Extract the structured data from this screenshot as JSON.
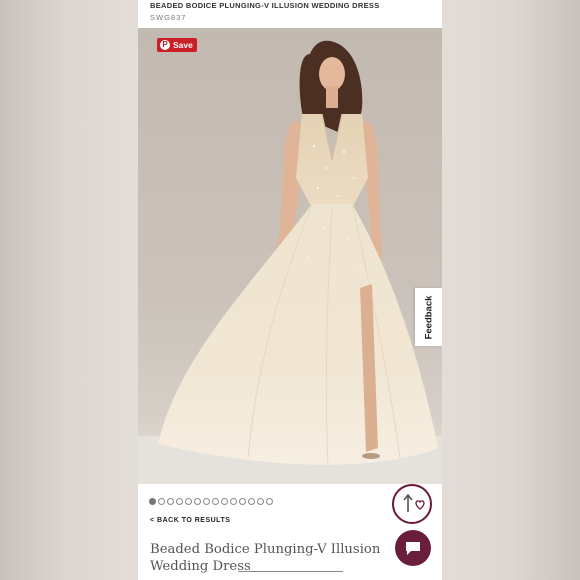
{
  "product": {
    "title_caps": "BEADED BODICE PLUNGING-V ILLUSION WEDDING DRESS",
    "sku": "SWG837",
    "name_line1": "Beaded Bodice Plunging-V Illusion",
    "name_line2": "Wedding Dress"
  },
  "pinterest": {
    "save_label": "Save",
    "icon": "pinterest-icon"
  },
  "feedback": {
    "label": "Feedback"
  },
  "gallery": {
    "dot_count": 14,
    "active_index": 0
  },
  "nav": {
    "back_label": "< BACK TO RESULTS"
  },
  "actions": {
    "share_icon": "share-heart-icon",
    "chat_icon": "chat-icon"
  },
  "colors": {
    "brand": "#6b1d3c",
    "pinterest": "#cb1f27"
  }
}
